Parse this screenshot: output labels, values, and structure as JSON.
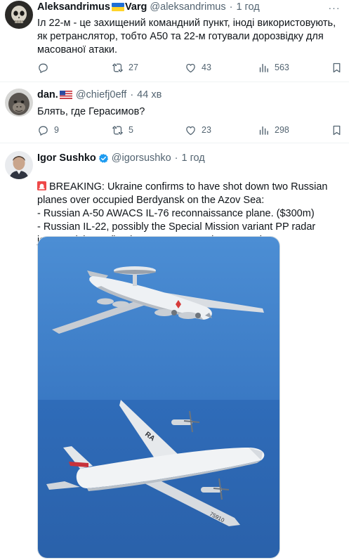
{
  "tweets": [
    {
      "author": "Aleksandrimus",
      "author_suffix": "Varg",
      "handle": "@aleksandrimus",
      "time": "1 год",
      "text": "Іл 22-м - це захищений командний пункт, іноді використовують, як ретранслятор, тобто А50 та 22-м готували дорозвідку для масованої атаки.",
      "replies": "",
      "retweets": "27",
      "likes": "43",
      "views": "563",
      "avatar_icon": "skull-avatar-icon",
      "flag_icon": "ukraine-flag-icon"
    },
    {
      "author": "dan.",
      "handle": "@chiefj0eff",
      "time": "44 хв",
      "text": "Блять, где Герасимов?",
      "replies": "9",
      "retweets": "5",
      "likes": "23",
      "views": "298",
      "avatar_icon": "chimp-avatar-icon",
      "flag_icon": "us-flag-icon"
    },
    {
      "author": "Igor Sushko",
      "handle": "@igorsushko",
      "time": "1 год",
      "text": "BREAKING: Ukraine confirms to have shot down two Russian planes over occupied Berdyansk on the Azov Sea:\n- Russian A-50 AWACS IL-76 reconnaissance plane. ($300m)\n- Russian IL-22, possibly the Special Mission variant PP radar jammer (pictured). Distress messages intercepted.",
      "avatar_icon": "person-avatar-icon",
      "badge_icon": "verified-badge-icon",
      "lead_icon": "siren-emoji-icon",
      "media": {
        "top_plane": "a50-awacs-plane",
        "bottom_plane": "il22-plane",
        "bottom_plane_markings": "RA",
        "bottom_plane_tail": "75910"
      }
    }
  ],
  "colors": {
    "text": "#0f1419",
    "muted": "#536471",
    "divider": "#eff3f4",
    "verified": "#1d9bf0",
    "sky_top": "#3c7fcb",
    "sky_bottom": "#2d67b3"
  }
}
